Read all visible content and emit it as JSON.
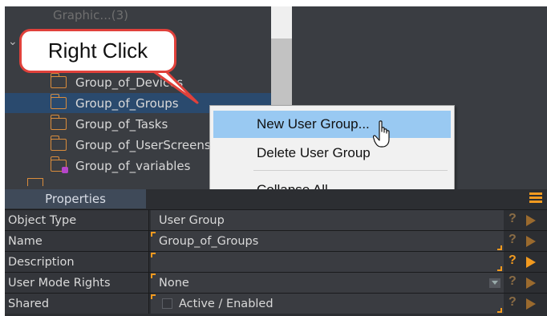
{
  "tree": {
    "top_faded_text": "Graphic...(3)",
    "items": [
      {
        "label": "Group_of_Devices",
        "selected": false,
        "icon": "folder-icon"
      },
      {
        "label": "Group_of_Groups",
        "selected": true,
        "icon": "folder-icon"
      },
      {
        "label": "Group_of_Tasks",
        "selected": false,
        "icon": "folder-icon"
      },
      {
        "label": "Group_of_UserScreens",
        "selected": false,
        "icon": "folder-icon"
      },
      {
        "label": "Group_of_variables",
        "selected": false,
        "icon": "variable-folder-icon"
      }
    ]
  },
  "callout": {
    "text": "Right Click"
  },
  "context_menu": {
    "items": [
      {
        "label": "New User Group...",
        "hover": true
      },
      {
        "label": "Delete User Group",
        "hover": false
      },
      {
        "label": "Collapse All",
        "hover": false
      }
    ]
  },
  "properties": {
    "tab_label": "Properties",
    "rows": [
      {
        "label": "Object Type",
        "value": "User Group"
      },
      {
        "label": "Name",
        "value": "Group_of_Groups"
      },
      {
        "label": "Description",
        "value": ""
      },
      {
        "label": "User Mode Rights",
        "value": "None"
      },
      {
        "label": "Shared",
        "value": "Active / Enabled"
      }
    ]
  },
  "colors": {
    "accent": "#f29a1f",
    "menu_hover": "#99c9f2",
    "callout_border": "#e0413b",
    "panel_bg": "#3a3d42"
  }
}
